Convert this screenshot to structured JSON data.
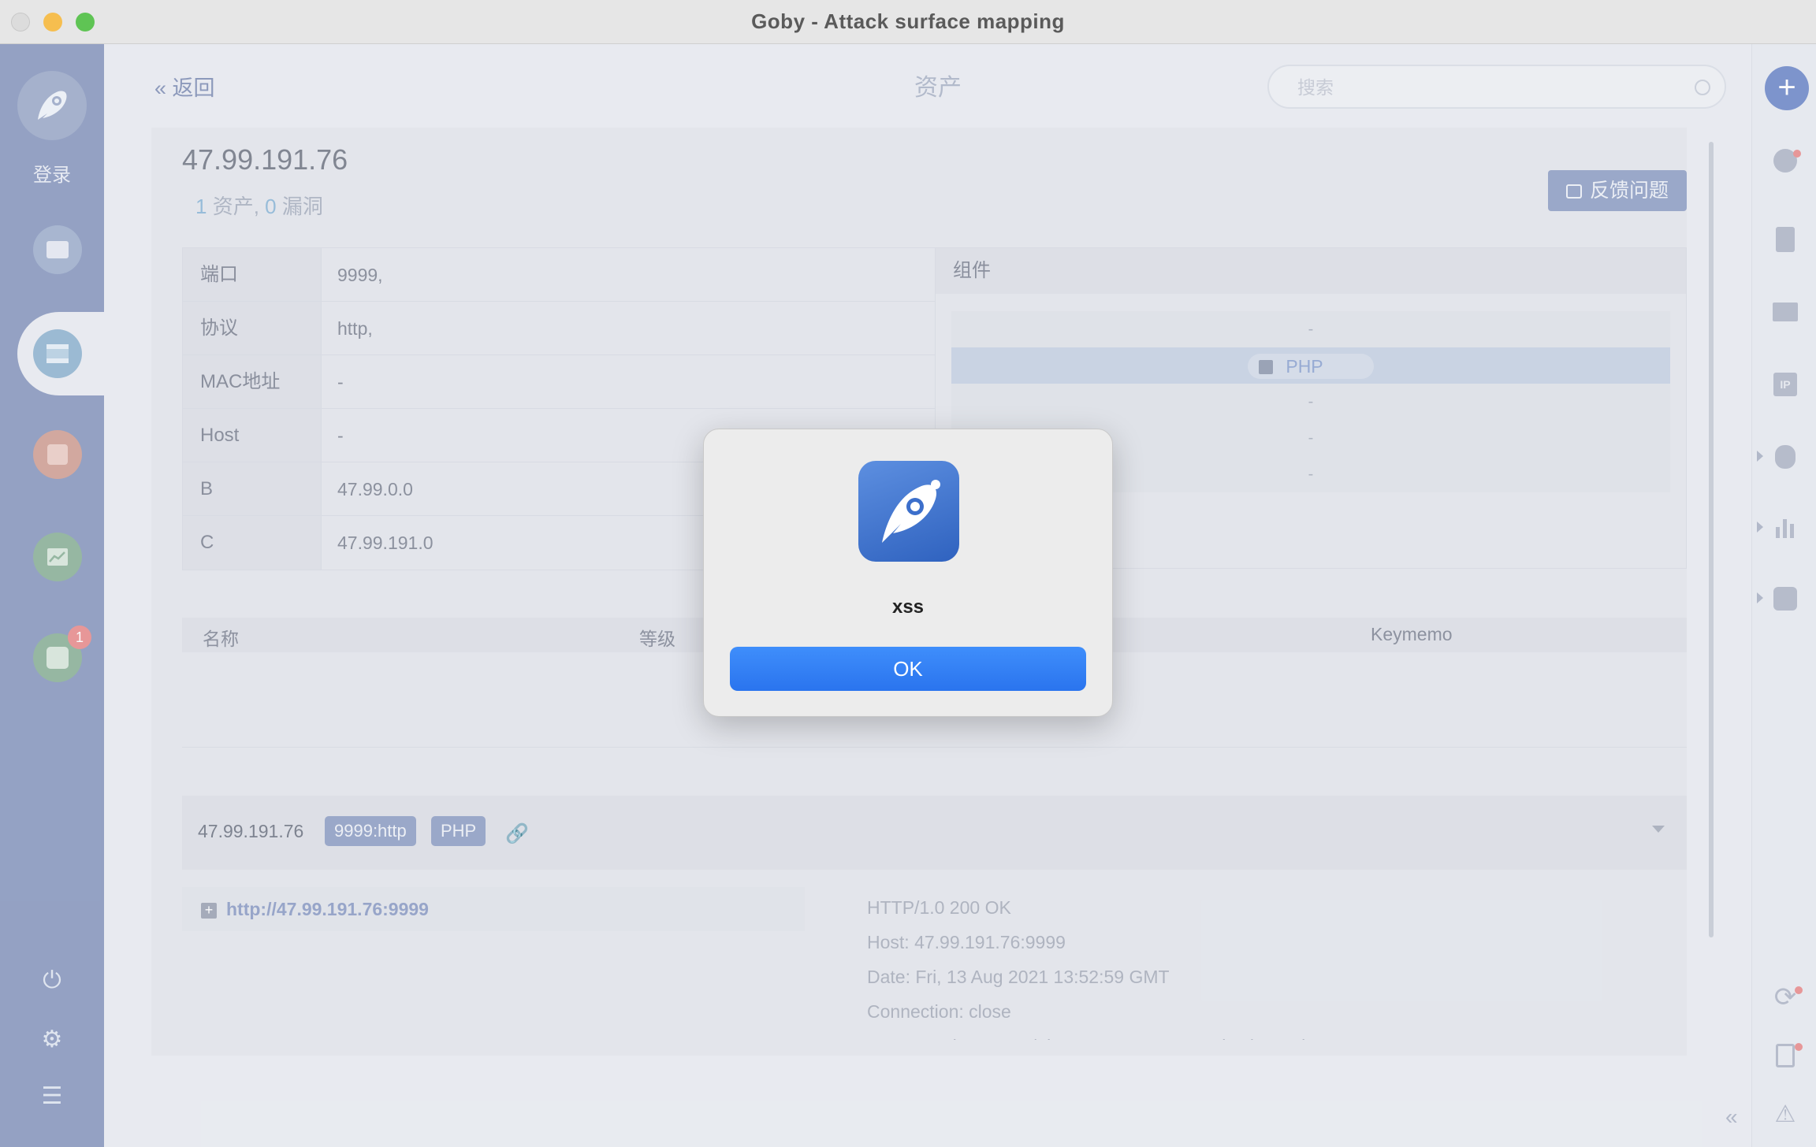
{
  "window": {
    "title": "Goby - Attack surface mapping"
  },
  "sidebar": {
    "login_label": "登录",
    "plugin_badge": "1"
  },
  "header": {
    "back_label": "返回",
    "page_title": "资产",
    "search_placeholder": "搜索"
  },
  "asset": {
    "ip": "47.99.191.76",
    "summary": {
      "asset_count": "1",
      "asset_label": "资产,",
      "vuln_count": "0",
      "vuln_label": "漏洞"
    },
    "feedback_label": "反馈问题",
    "info_rows": [
      {
        "key": "端口",
        "value": "9999,"
      },
      {
        "key": "协议",
        "value": "http,"
      },
      {
        "key": "MAC地址",
        "value": "-"
      },
      {
        "key": "Host",
        "value": "-"
      },
      {
        "key": "B",
        "value": "47.99.0.0"
      },
      {
        "key": "C",
        "value": "47.99.191.0"
      }
    ],
    "components": {
      "header": "组件",
      "rows": [
        "-",
        "PHP",
        "-",
        "-",
        "-"
      ]
    }
  },
  "vuln_table": {
    "columns": [
      "名称",
      "等级",
      "Keymemo"
    ]
  },
  "service": {
    "ip": "47.99.191.76",
    "chips": [
      "9999:http",
      "PHP"
    ],
    "url": "http://47.99.191.76:9999",
    "response_lines": [
      "HTTP/1.0 200 OK",
      "Host: 47.99.191.76:9999",
      "Date: Fri, 13 Aug 2021 13:52:59 GMT",
      "Connection: close",
      "X-Powered-By: PHP/<img src=\"x\" onerror=alert(\"XSS\")>"
    ]
  },
  "dialog": {
    "message": "xss",
    "ok_label": "OK"
  },
  "colors": {
    "accent": "#2a74ee",
    "sidebar": "#8696bd",
    "chip": "#8e9ec3"
  }
}
